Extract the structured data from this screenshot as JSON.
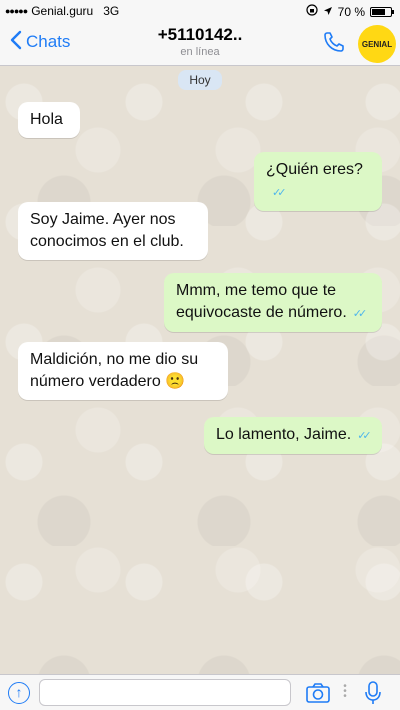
{
  "status_bar": {
    "signal": "●●●●●",
    "carrier": "Genial.guru",
    "network": "3G",
    "battery_percent": "70 %",
    "battery_level": 0.7
  },
  "header": {
    "back_label": "Chats",
    "contact_number": "+5110142..",
    "contact_status": "en línea",
    "logo_text": "GENIAL"
  },
  "chat": {
    "date_label": "Hoy",
    "messages": [
      {
        "direction": "in",
        "text": "Hola"
      },
      {
        "direction": "out",
        "text": "¿Quién eres?",
        "status": "read"
      },
      {
        "direction": "in",
        "text": "Soy Jaime. Ayer nos conocimos en el club."
      },
      {
        "direction": "out",
        "text": "Mmm, me temo que te equivocaste de número.",
        "status": "read"
      },
      {
        "direction": "in",
        "text": "Maldición, no me dio su número verdadero 🙁"
      },
      {
        "direction": "out",
        "text": "Lo lamento, Jaime.",
        "status": "read"
      }
    ]
  },
  "input": {
    "value": "",
    "placeholder": ""
  },
  "colors": {
    "accent": "#1f7cf6",
    "outgoing_bubble": "#dcf8c6",
    "incoming_bubble": "#ffffff",
    "read_ticks": "#4fb6ec",
    "logo_bg": "#ffd814"
  }
}
